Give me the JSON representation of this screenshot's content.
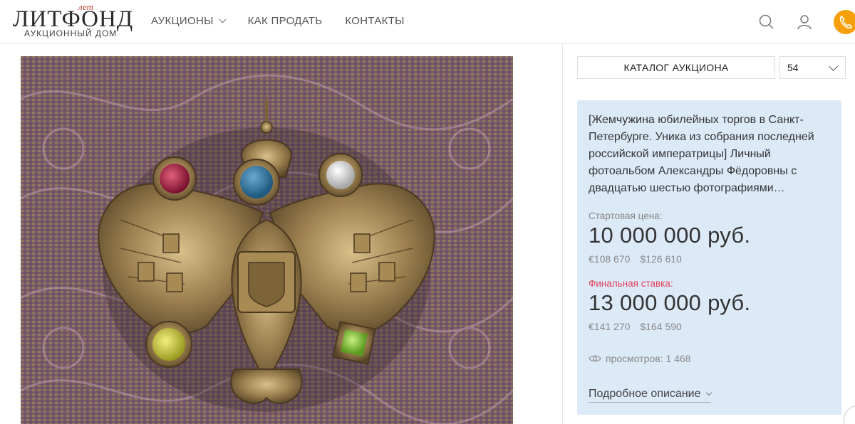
{
  "logo": {
    "main": "ЛИТФОНД",
    "years": "лет",
    "subtitle": "АУКЦИОННЫЙ ДОМ"
  },
  "nav": {
    "items": [
      {
        "label": "АУКЦИОНЫ"
      },
      {
        "label": "КАК ПРОДАТЬ"
      },
      {
        "label": "КОНТАКТЫ"
      }
    ]
  },
  "header_icons": [
    "search-icon",
    "user-icon",
    "phone-icon"
  ],
  "catalog": {
    "button_label": "КАТАЛОГ АУКЦИОНА",
    "lot_number": "54"
  },
  "lot": {
    "title": "[Жемчужина юбилейных торгов в Санкт-Петербурге. Уника из собрания последней российской императрицы] Личный фотоальбом Александры Фёдоровны с двадцатью шестью фотографиями…",
    "start_label": "Стартовая цена:",
    "start_price": "10 000 000 руб.",
    "start_eur": "€108 670",
    "start_usd": "$126 610",
    "final_label": "Финальная ставка:",
    "final_price": "13 000 000 руб.",
    "final_eur": "€141 270",
    "final_usd": "$164 590",
    "views": "просмотров: 1 468",
    "details_label": "Подробное описание"
  },
  "colors": {
    "accent": "#f5a00a",
    "card_bg": "#dceaf8",
    "final_label": "#e0405a"
  }
}
